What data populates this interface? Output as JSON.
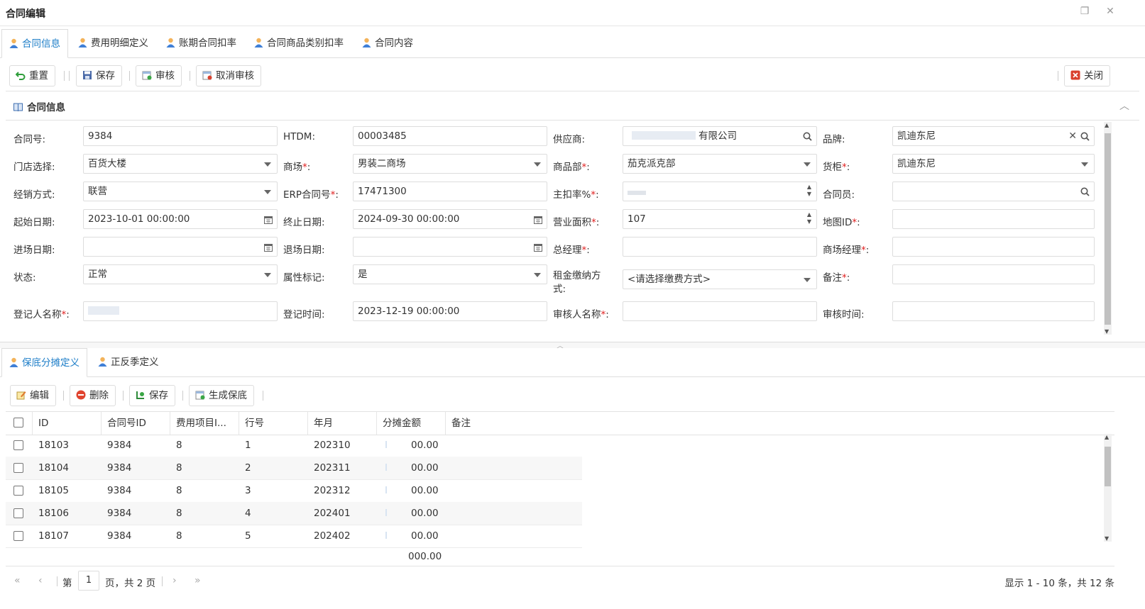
{
  "window": {
    "title": "合同编辑"
  },
  "top_tabs": [
    {
      "label": "合同信息",
      "active": true
    },
    {
      "label": "费用明细定义"
    },
    {
      "label": "账期合同扣率"
    },
    {
      "label": "合同商品类别扣率"
    },
    {
      "label": "合同内容"
    }
  ],
  "toolbar": {
    "reset": "重置",
    "save": "保存",
    "audit": "审核",
    "cancel_audit": "取消审核",
    "close": "关闭"
  },
  "panel": {
    "title": "合同信息"
  },
  "form": {
    "contract_no": {
      "label": "合同号:",
      "value": "9384"
    },
    "htdm": {
      "label": "HTDM:",
      "value": "00003485"
    },
    "supplier": {
      "label": "供应商:",
      "value": "有限公司"
    },
    "brand": {
      "label": "品牌:",
      "value": "凯迪东尼"
    },
    "store": {
      "label": "门店选择:",
      "value": "百货大楼"
    },
    "mall": {
      "label": "商场",
      "value": "男装二商场"
    },
    "dept": {
      "label": "商品部",
      "value": "茄克派克部"
    },
    "counter": {
      "label": "货柜",
      "value": "凯迪东尼"
    },
    "sale_mode": {
      "label": "经销方式:",
      "value": "联营"
    },
    "erp_no": {
      "label": "ERP合同号",
      "value": "17471300"
    },
    "main_rate": {
      "label": "主扣率%",
      "value": ""
    },
    "clerk": {
      "label": "合同员:",
      "value": ""
    },
    "start_date": {
      "label": "起始日期:",
      "value": "2023-10-01 00:00:00"
    },
    "end_date": {
      "label": "终止日期:",
      "value": "2024-09-30 00:00:00"
    },
    "area": {
      "label": "营业面积",
      "value": "107"
    },
    "map_id": {
      "label": "地图ID",
      "value": ""
    },
    "entry_date": {
      "label": "进场日期:",
      "value": ""
    },
    "exit_date": {
      "label": "退场日期:",
      "value": ""
    },
    "gm": {
      "label": "总经理",
      "value": ""
    },
    "mall_manager": {
      "label": "商场经理",
      "value": ""
    },
    "status": {
      "label": "状态:",
      "value": "正常"
    },
    "attr_flag": {
      "label": "属性标记:",
      "value": "是"
    },
    "rent_mode": {
      "label": "租金缴纳方式:",
      "value": "<请选择缴费方式>"
    },
    "remark": {
      "label": "备注",
      "value": ""
    },
    "registrant": {
      "label": "登记人名称",
      "value": ""
    },
    "reg_time": {
      "label": "登记时间:",
      "value": "2023-12-19 00:00:00"
    },
    "auditor": {
      "label": "审核人名称",
      "value": ""
    },
    "audit_time": {
      "label": "审核时间:",
      "value": ""
    }
  },
  "bottom_tabs": [
    {
      "label": "保底分摊定义",
      "active": true
    },
    {
      "label": "正反季定义"
    }
  ],
  "grid_toolbar": {
    "edit": "编辑",
    "delete": "删除",
    "save": "保存",
    "generate": "生成保底"
  },
  "grid": {
    "columns": [
      "ID",
      "合同号ID",
      "费用项目I...",
      "行号",
      "年月",
      "分摊金额",
      "备注"
    ],
    "rows": [
      [
        "18103",
        "9384",
        "8",
        "1",
        "202310",
        "00.00",
        ""
      ],
      [
        "18104",
        "9384",
        "8",
        "2",
        "202311",
        "00.00",
        ""
      ],
      [
        "18105",
        "9384",
        "8",
        "3",
        "202312",
        "00.00",
        ""
      ],
      [
        "18106",
        "9384",
        "8",
        "4",
        "202401",
        "00.00",
        ""
      ],
      [
        "18107",
        "9384",
        "8",
        "5",
        "202402",
        "00.00",
        ""
      ]
    ],
    "total": "000.00"
  },
  "pager": {
    "prefix": "第",
    "page": "1",
    "suffix": "页，共 2 页",
    "summary": "显示 1 - 10 条，共 12 条"
  },
  "colors": {
    "accent": "#1e7ec8",
    "border": "#dddddd",
    "required": "#e02020"
  }
}
